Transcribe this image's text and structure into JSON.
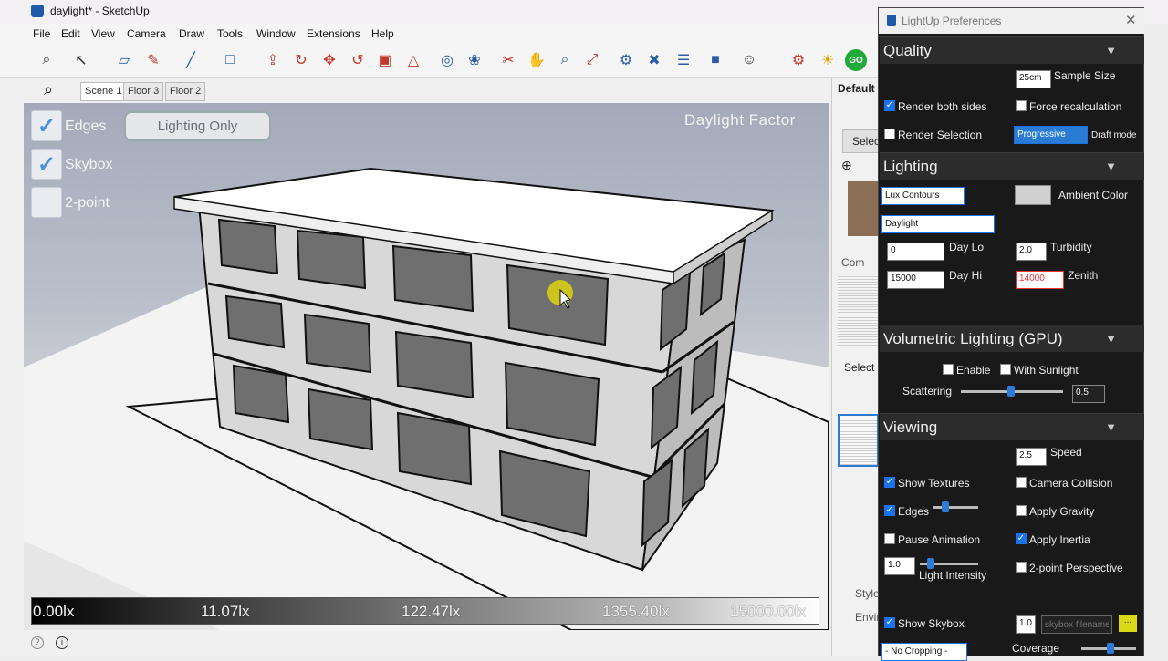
{
  "window": {
    "title": "daylight* - SketchUp"
  },
  "menu": [
    "File",
    "Edit",
    "View",
    "Camera",
    "Draw",
    "Tools",
    "Window",
    "Extensions",
    "Help"
  ],
  "toolbar": {
    "icons": [
      "search-icon",
      "select-icon",
      "eraser-icon",
      "pencil-icon",
      "line-icon",
      "shape-icon",
      "pushpull-icon",
      "followme-icon",
      "move-icon",
      "rotate-icon",
      "scale-icon",
      "offset-icon",
      "tape-icon",
      "paint-icon",
      "section-icon",
      "orbit-icon",
      "zoom-icon",
      "zoomextents-icon",
      "warehouse-icon",
      "components-icon",
      "layers-icon",
      "extension-icon",
      "account-icon",
      "lightup-icon",
      "bulb-icon",
      "go-icon"
    ],
    "go_label": "GO"
  },
  "scenes": {
    "tabs": [
      "Scene 1",
      "Floor 3",
      "Floor 2"
    ],
    "active": "Scene 1"
  },
  "viewport": {
    "checks": [
      {
        "label": "Edges",
        "checked": true
      },
      {
        "label": "Skybox",
        "checked": true
      },
      {
        "label": "2-point",
        "checked": false
      }
    ],
    "lighting_button": "Lighting Only",
    "title": "Daylight Factor",
    "legend": [
      "0.00lx",
      "11.07lx",
      "122.47lx",
      "1355.40lx",
      "15000.00lx"
    ]
  },
  "tray": {
    "default_label": "Default",
    "select_label": "Selec",
    "components_label": "Com",
    "select2_label": "Select",
    "styles_label": "Style",
    "envir_label": "Envir"
  },
  "panel": {
    "title": "LightUp Preferences",
    "quality": {
      "header": "Quality",
      "sample_value": "25cm",
      "sample_label": "Sample Size",
      "render_both_sides": "Render both sides",
      "force_recalc": "Force recalculation",
      "render_selection": "Render Selection",
      "mode_value": "Progressive",
      "mode_label": "Draft mode"
    },
    "lighting": {
      "header": "Lighting",
      "contour_value": "Lux Contours",
      "ambient_label": "Ambient Color",
      "ambient_color": "#d0d0d0",
      "sky_value": "Daylight",
      "daylo_value": "0",
      "daylo_label": "Day Lo",
      "turbidity_value": "2.0",
      "turbidity_label": "Turbidity",
      "dayhi_value": "15000",
      "dayhi_label": "Day Hi",
      "zenith_value": "14000",
      "zenith_label": "Zenith"
    },
    "volumetric": {
      "header": "Volumetric Lighting (GPU)",
      "enable": "Enable",
      "with_sunlight": "With Sunlight",
      "scattering_label": "Scattering",
      "scattering_value": "0.5"
    },
    "viewing": {
      "header": "Viewing",
      "speed_value": "2.5",
      "speed_label": "Speed",
      "show_textures": "Show Textures",
      "camera_collision": "Camera Collision",
      "edges": "Edges",
      "apply_gravity": "Apply Gravity",
      "pause_animation": "Pause Animation",
      "apply_inertia": "Apply Inertia",
      "light_intensity_value": "1.0",
      "light_intensity_label": "Light Intensity",
      "two_point": "2-point Perspective",
      "show_skybox": "Show Skybox",
      "skybox_value": "1.0",
      "skybox_placeholder": "skybox filename",
      "cropping_value": "- No Cropping -",
      "coverage_label": "Coverage"
    }
  },
  "colors": {
    "accent": "#1a73e8",
    "go_green": "#1faa3a"
  }
}
